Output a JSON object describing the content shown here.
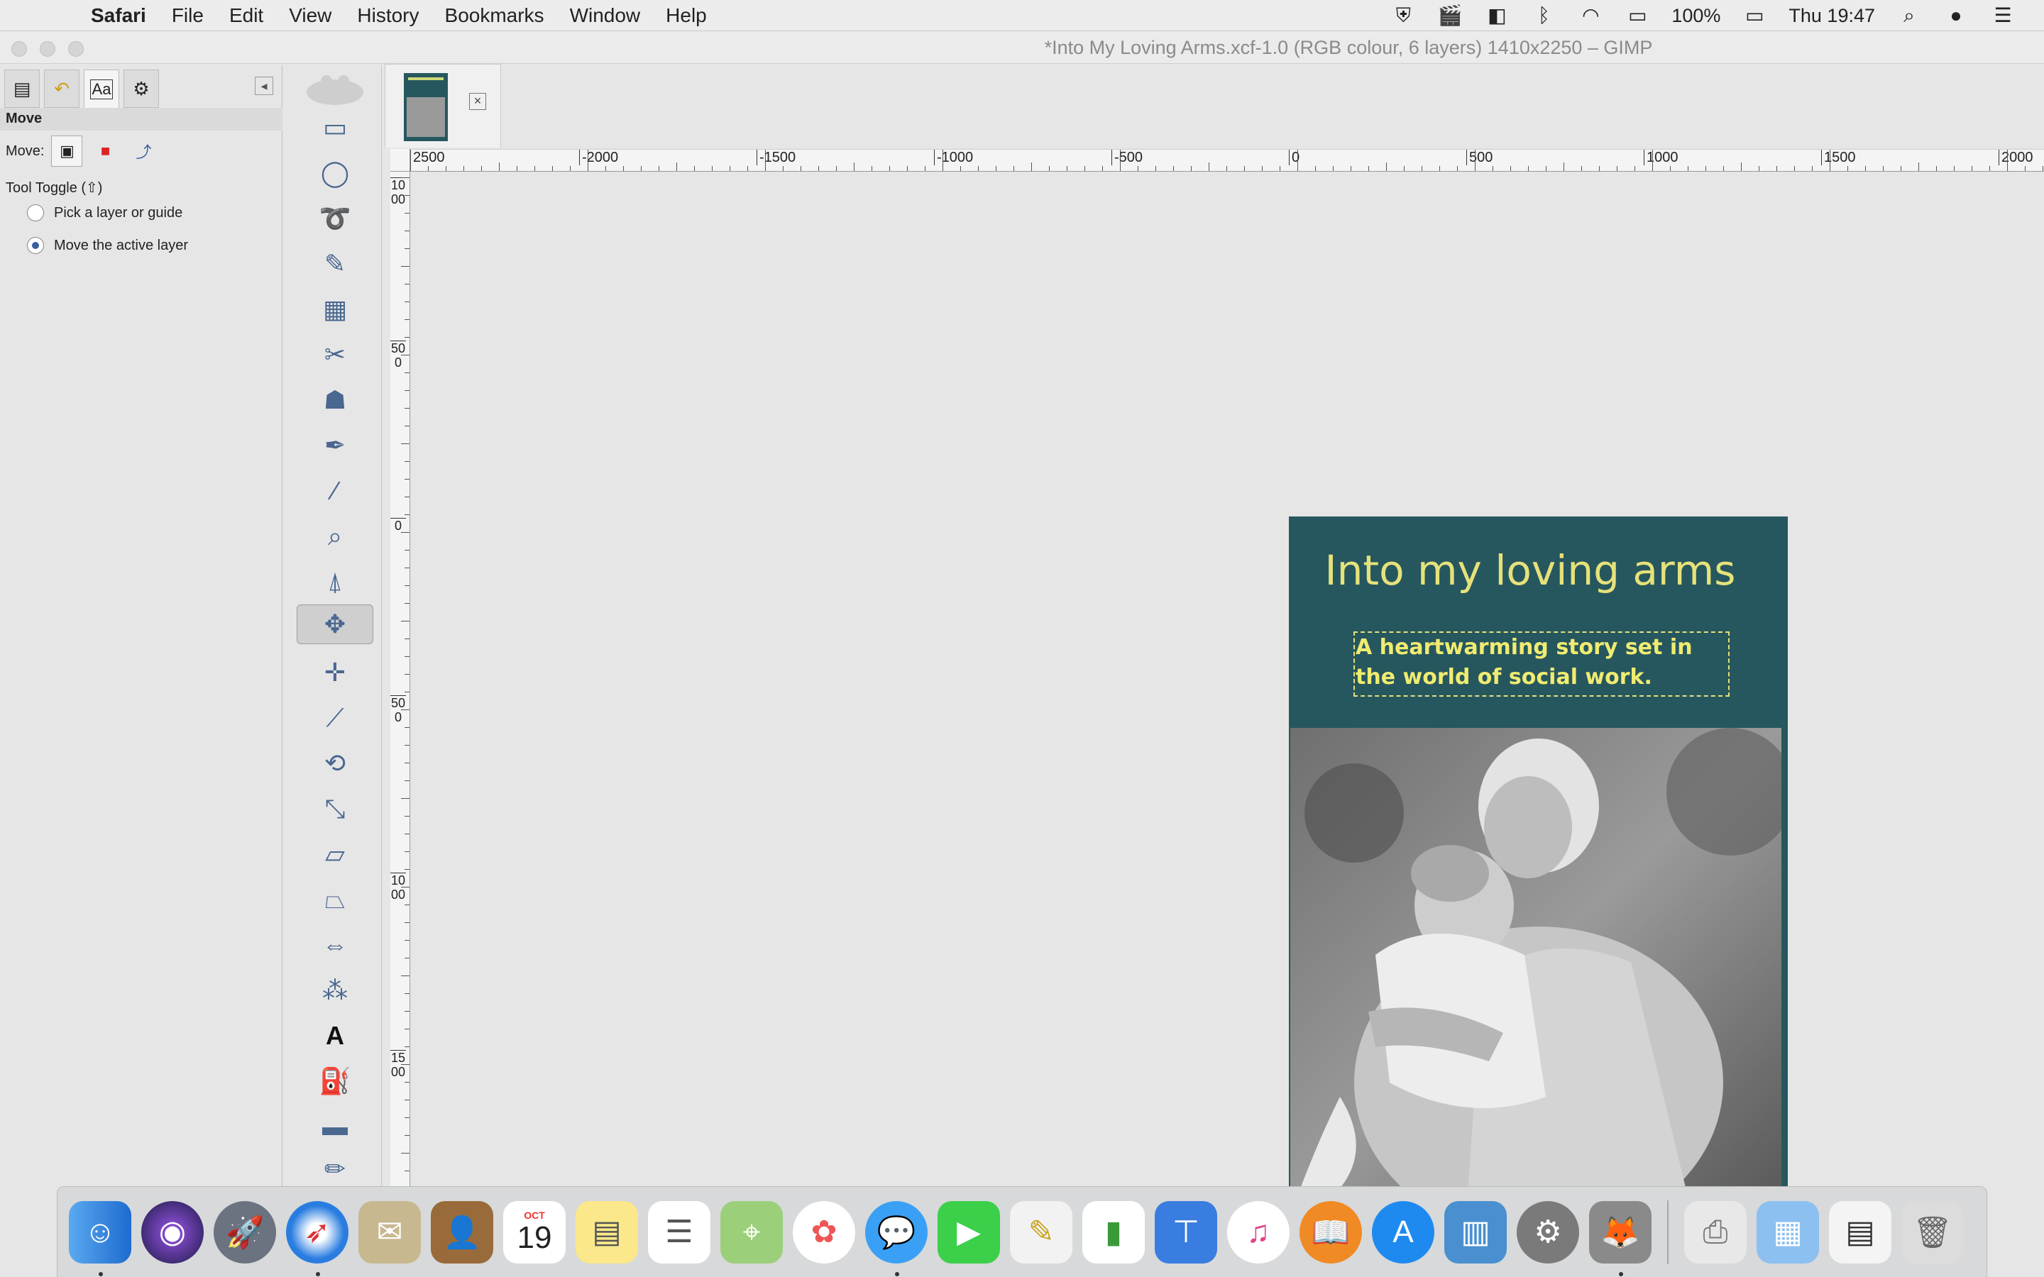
{
  "menubar": {
    "app": "Safari",
    "menus": [
      "File",
      "Edit",
      "View",
      "History",
      "Bookmarks",
      "Window",
      "Help"
    ],
    "battery": "100%",
    "clock": "Thu 19:47"
  },
  "window": {
    "title": "*Into My Loving Arms.xcf-1.0 (RGB colour, 6 layers) 1410x2250 – GIMP"
  },
  "tool_options": {
    "title": "Move",
    "move_label": "Move:",
    "toggle_label": "Tool Toggle  (⇧)",
    "options": [
      {
        "label": "Pick a layer or guide",
        "selected": false
      },
      {
        "label": "Move the active layer",
        "selected": true
      }
    ]
  },
  "rulers": {
    "horizontal": [
      "2500",
      "-2000",
      "-1500",
      "-1000",
      "-500",
      "0",
      "500",
      "1000",
      "1500",
      "2000"
    ],
    "vertical": [
      "1000",
      "500",
      "0",
      "500",
      "1000",
      "1500"
    ]
  },
  "poster": {
    "title": "Into my loving arms",
    "subtitle": "A heartwarming story set in the world of social work.",
    "background": "#27575e",
    "text_color": "#e6e27a"
  },
  "dock": {
    "calendar_month": "OCT",
    "calendar_day": "19"
  }
}
